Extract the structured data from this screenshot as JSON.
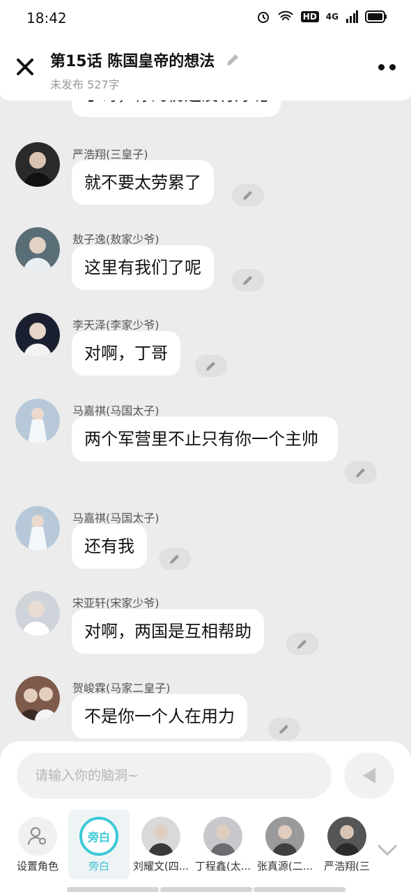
{
  "status": {
    "time": "18:42",
    "hd": "HD",
    "net": "4G"
  },
  "header": {
    "title": "第15话  陈国皇帝的想法",
    "subtitle": "未发布 527字"
  },
  "partial_message": {
    "text": "丁哥，你的伤还没有好呢"
  },
  "messages": [
    {
      "name": "严浩翔(三皇子)",
      "text": "就不要太劳累了",
      "avatar_color": "#2a2a2a"
    },
    {
      "name": "敖子逸(敖家少爷)",
      "text": "这里有我们了呢",
      "avatar_color": "#5a6e78"
    },
    {
      "name": "李天泽(李家少爷)",
      "text": "对啊，丁哥",
      "avatar_color": "#1b2030"
    },
    {
      "name": "马嘉祺(马国太子)",
      "text": "两个军营里不止只有你一个主帅",
      "avatar_color": "#b7c9d9"
    },
    {
      "name": "马嘉祺(马国太子)",
      "text": "还有我",
      "avatar_color": "#b7c9d9"
    },
    {
      "name": "宋亚轩(宋家少爷)",
      "text": "对啊，两国是互相帮助",
      "avatar_color": "#cfd4da"
    },
    {
      "name": "贺峻霖(马家二皇子)",
      "text": "不是你一个人在用力",
      "avatar_color": "#7d5a4a"
    }
  ],
  "composer": {
    "placeholder": "请输入你的脑洞~"
  },
  "roles": [
    {
      "label": "设置角色",
      "icon": "person-settings-icon"
    },
    {
      "label": "旁白",
      "badge": "旁白"
    },
    {
      "label": "刘耀文(四...",
      "color": "#3a3a3a"
    },
    {
      "label": "丁程鑫(太...",
      "color": "#6b6b70"
    },
    {
      "label": "张真源(二...",
      "color": "#404040"
    },
    {
      "label": "严浩翔(三",
      "color": "#2a2a2a"
    }
  ],
  "colors": {
    "accent": "#3cc8d6",
    "background": "#ececec"
  }
}
